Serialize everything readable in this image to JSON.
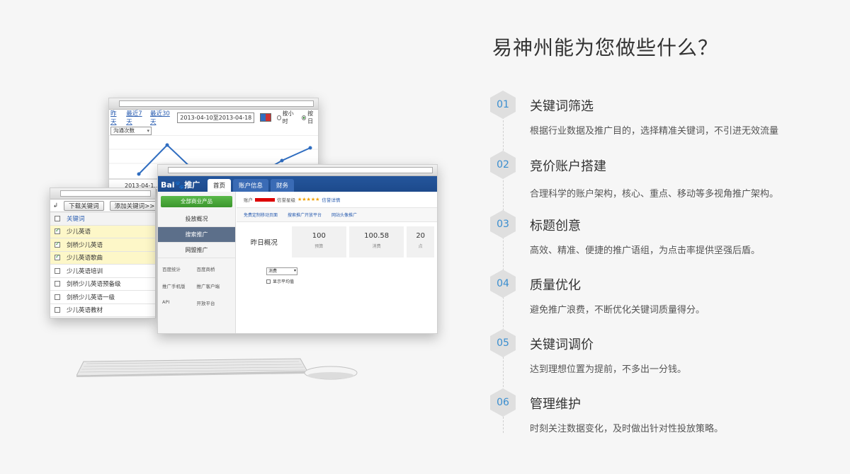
{
  "heading": "易神州能为您做些什么？",
  "services": [
    {
      "num": "01",
      "title": "关键词筛选",
      "desc": "根据行业数据及推广目的，选择精准关键词，不引进无效流量"
    },
    {
      "num": "02",
      "title": "竞价账户搭建",
      "desc": "合理科学的账户架构，核心、重点、移动等多视角推广架构。"
    },
    {
      "num": "03",
      "title": "标题创意",
      "desc": "高效、精准、便捷的推广语组，为点击率提供坚强后盾。"
    },
    {
      "num": "04",
      "title": "质量优化",
      "desc": "避免推广浪费，不断优化关键词质量得分。"
    },
    {
      "num": "05",
      "title": "关键词调价",
      "desc": "达到理想位置为提前，不多出一分钱。"
    },
    {
      "num": "06",
      "title": "管理维护",
      "desc": "时刻关注数据变化，及时做出针对性投放策略。"
    }
  ],
  "chart_window": {
    "range_links": [
      "昨天",
      "最近7天",
      "最近30天"
    ],
    "date_range": "2013-04-10至2013-04-18",
    "radio_hour": "按小时",
    "radio_day": "按日",
    "metric_select": "沟通次数",
    "x_label": "2013-04-1..."
  },
  "keyword_window": {
    "arrow": "↲",
    "download_button": "下载关键词",
    "add_button": "添加关键词>>",
    "header": "关键词",
    "rows": [
      {
        "text": "少儿英语",
        "checked": true
      },
      {
        "text": "剑桥少儿英语",
        "checked": true
      },
      {
        "text": "少儿英语歌曲",
        "checked": true
      },
      {
        "text": "少儿英语培训",
        "checked": false
      },
      {
        "text": "剑桥少儿英语预备级",
        "checked": false
      },
      {
        "text": "剑桥少儿英语一级",
        "checked": false
      },
      {
        "text": "少儿英语教材",
        "checked": false
      }
    ]
  },
  "baidu_window": {
    "logo": "Bai🐾推广",
    "tabs": [
      "首页",
      "账户信息",
      "财务"
    ],
    "green_button": "全部商业产品",
    "menu": [
      "投放概况",
      "搜索推广",
      "网盟推广"
    ],
    "links": [
      "百度统计",
      "百度商桥",
      "推广手机版",
      "推广客户端",
      "API",
      "开放平台"
    ],
    "account_label": "账户",
    "credit_label": "信誉星级",
    "stars": "★★★★★",
    "credit_link": "信誉详情",
    "quick_links": [
      "免费定制移动页面",
      "搜索推广开放平台",
      "网站头像推广"
    ],
    "summary_title": "昨日概况",
    "stats": [
      {
        "value": "100",
        "label": "预算"
      },
      {
        "value": "100.58",
        "label": "消费"
      },
      {
        "value": "20",
        "label": "点"
      }
    ],
    "select": "消费",
    "checkbox_label": "显示平均值"
  },
  "colors": {
    "accent": "#3a8ed0",
    "hex_bg": "#dfdfdf",
    "baidu_blue": "#1d4a8c"
  }
}
